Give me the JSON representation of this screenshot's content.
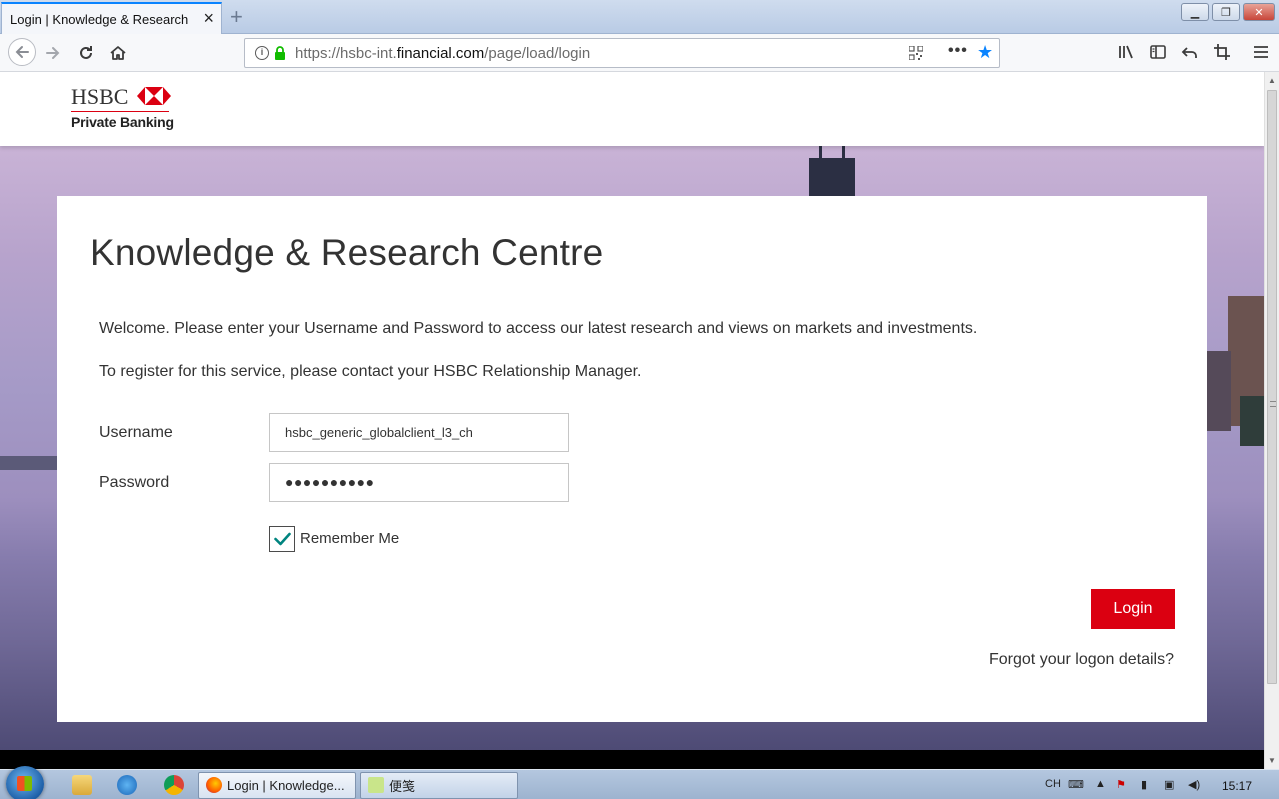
{
  "browser": {
    "tab_title": "Login | Knowledge & Research C",
    "url_prefix": "https://hsbc-int.",
    "url_domain": "financial.com",
    "url_path": "/page/load/login",
    "accent_color": "#0a84ff"
  },
  "header": {
    "logo_text": "HSBC",
    "logo_subtitle": "Private Banking",
    "brand_color": "#db0011"
  },
  "login": {
    "title": "Knowledge & Research Centre",
    "intro_1": "Welcome. Please enter your Username and Password to access our latest research and views on markets and investments.",
    "intro_2": "To register for this service, please contact your HSBC Relationship Manager.",
    "username_label": "Username",
    "username_value": "hsbc_generic_globalclient_l3_ch",
    "password_label": "Password",
    "password_masked": "●●●●●●●●●●",
    "remember_label": "Remember Me",
    "remember_checked": true,
    "login_button": "Login",
    "forgot_link": "Forgot your logon details?"
  },
  "taskbar": {
    "task_1": "Login | Knowledge...",
    "task_2": "便笺",
    "lang": "CH",
    "clock": "15:17"
  }
}
